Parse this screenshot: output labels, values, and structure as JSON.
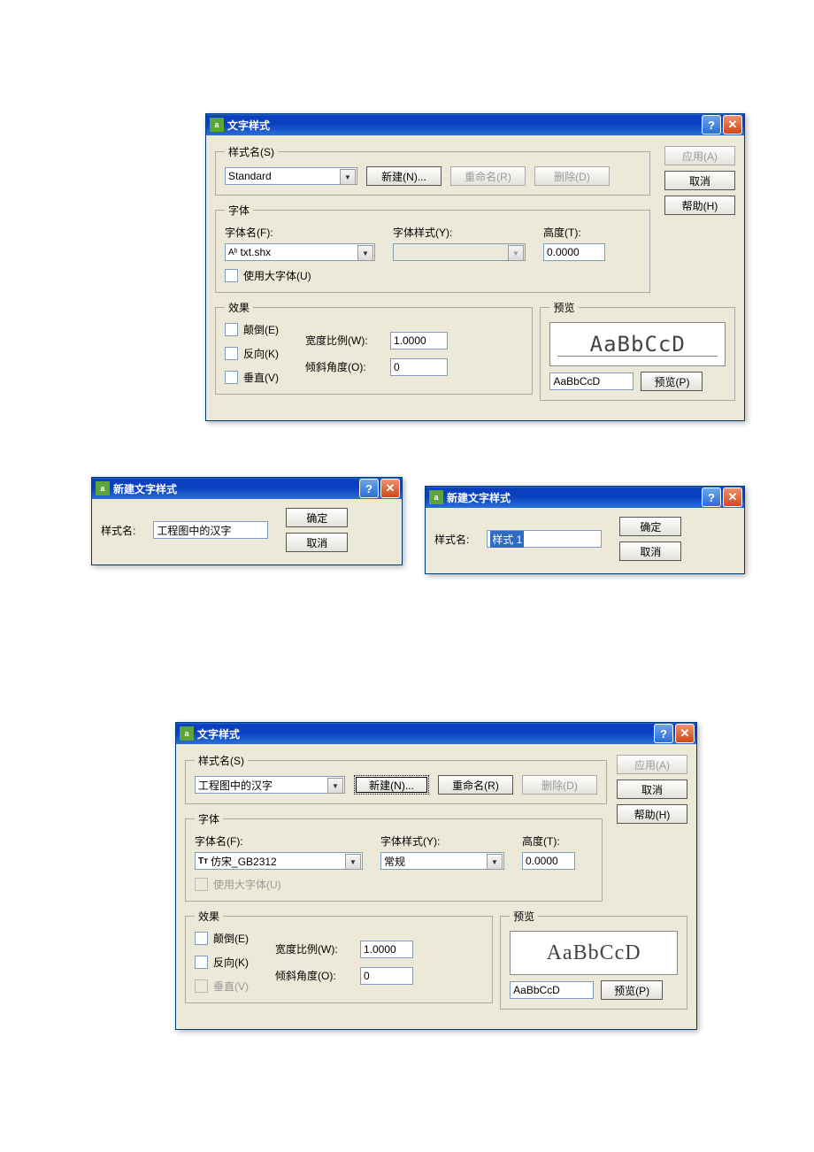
{
  "d1": {
    "title": "文字样式",
    "apply": "应用(A)",
    "cancel": "取消",
    "help": "帮助(H)",
    "styleName": {
      "legend": "样式名(S)",
      "value": "Standard",
      "new": "新建(N)...",
      "rename": "重命名(R)",
      "delete": "删除(D)"
    },
    "font": {
      "legend": "字体",
      "nameLabel": "字体名(F):",
      "nameValue": "txt.shx",
      "styleLabel": "字体样式(Y):",
      "styleValue": "",
      "heightLabel": "高度(T):",
      "heightValue": "0.0000",
      "bigFont": "使用大字体(U)"
    },
    "effects": {
      "legend": "效果",
      "upside": "颠倒(E)",
      "backward": "反向(K)",
      "vertical": "垂直(V)",
      "widthLabel": "宽度比例(W):",
      "widthValue": "1.0000",
      "obliqueLabel": "倾斜角度(O):",
      "obliqueValue": "0"
    },
    "preview": {
      "legend": "预览",
      "sample": "AaBbCcD",
      "value": "AaBbCcD",
      "button": "预览(P)"
    }
  },
  "d2": {
    "title": "新建文字样式",
    "label": "样式名:",
    "value": "工程图中的汉字",
    "ok": "确定",
    "cancel": "取消"
  },
  "d3": {
    "title": "新建文字样式",
    "label": "样式名:",
    "value": "样式 1",
    "ok": "确定",
    "cancel": "取消"
  },
  "d4": {
    "title": "文字样式",
    "apply": "应用(A)",
    "cancel": "取消",
    "help": "帮助(H)",
    "styleName": {
      "legend": "样式名(S)",
      "value": "工程图中的汉字",
      "new": "新建(N)...",
      "rename": "重命名(R)",
      "delete": "删除(D)"
    },
    "font": {
      "legend": "字体",
      "nameLabel": "字体名(F):",
      "nameValue": "仿宋_GB2312",
      "styleLabel": "字体样式(Y):",
      "styleValue": "常规",
      "heightLabel": "高度(T):",
      "heightValue": "0.0000",
      "bigFont": "使用大字体(U)"
    },
    "effects": {
      "legend": "效果",
      "upside": "颠倒(E)",
      "backward": "反向(K)",
      "vertical": "垂直(V)",
      "widthLabel": "宽度比例(W):",
      "widthValue": "1.0000",
      "obliqueLabel": "倾斜角度(O):",
      "obliqueValue": "0"
    },
    "preview": {
      "legend": "预览",
      "sample": "AaBbCcD",
      "value": "AaBbCcD",
      "button": "预览(P)"
    }
  }
}
